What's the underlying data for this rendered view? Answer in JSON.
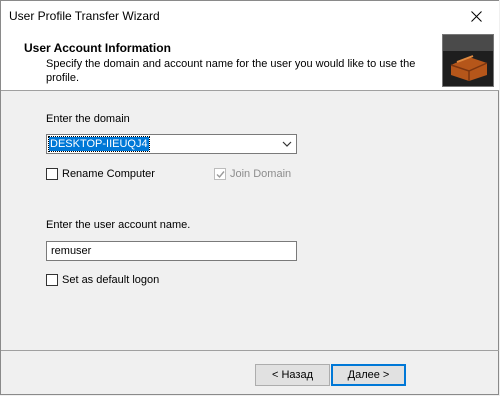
{
  "window": {
    "title": "User Profile Transfer Wizard"
  },
  "banner": {
    "title": "User Account  Information",
    "subtitle": "Specify the domain and account name for the user you would like to use the profile."
  },
  "domain": {
    "label": "Enter the domain",
    "value": "DESKTOP-IIEUQJ4"
  },
  "rename_computer": {
    "label": "Rename Computer",
    "checked": false
  },
  "join_domain": {
    "label": "Join Domain",
    "checked": true,
    "disabled": true
  },
  "account": {
    "label": "Enter the user account name.",
    "value": "remuser"
  },
  "default_logon": {
    "label": "Set as default logon",
    "checked": false
  },
  "buttons": {
    "back": "< Назад",
    "next": "Далее >"
  },
  "icons": {
    "close": "close-icon",
    "dropdown": "chevron-down-icon",
    "check": "checkmark-icon"
  }
}
